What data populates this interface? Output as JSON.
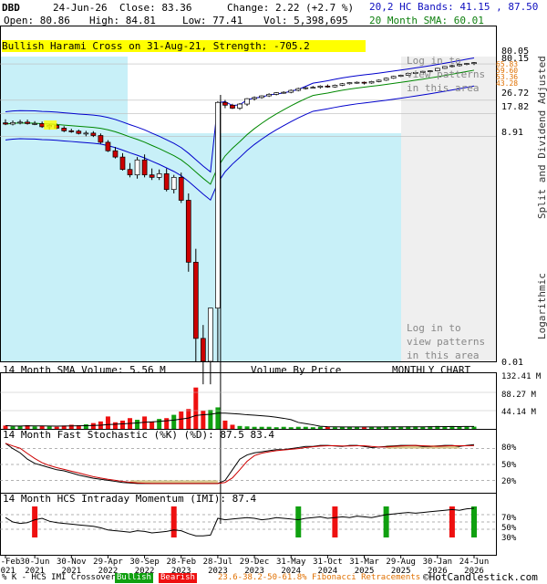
{
  "header": {
    "ticker": "DBD",
    "date": "24-Jun-26",
    "close": "Close: 83.36",
    "change": "Change: 2.22 (+2.7 %)",
    "open": "Open: 80.86",
    "high": "High: 84.81",
    "low": "Low: 77.41",
    "vol": "Vol: 5,398,695",
    "bands": "20,2 HC Bands: 41.15 , 87.50",
    "sma": "20 Month SMA: 60.01"
  },
  "pattern_banner": "Bullish Harami Cross on 31-Aug-21, Strength: -705.2",
  "login_text_1": "Log in to\nview patterns\nin this area",
  "login_text_2": "Log in to\nview patterns\nin this area",
  "right_axis_main": [
    "80.05",
    "80.15",
    "26.72",
    "17.82",
    "8.91",
    "0.01"
  ],
  "fib_labels": [
    "65.83",
    "59.60",
    "53.36",
    "43.28"
  ],
  "volume_panel": {
    "label": "14 Month SMA Volume: 5.56 M",
    "vbp": "Volume By Price",
    "chart_type": "MONTHLY CHART",
    "axis": [
      "132.41 M",
      "88.27 M",
      "44.14 M"
    ]
  },
  "stoch_panel": {
    "label": "14 Month Fast Stochastic (%K) (%D): 87.5 83.4",
    "axis": [
      "80%",
      "50%",
      "20%"
    ]
  },
  "momentum_panel": {
    "label": "14 Month HCS Intraday Momentum (IMI): 87.4",
    "axis": [
      "70%",
      "50%",
      "30%"
    ]
  },
  "side_labels": {
    "split": "Split and Dividend Adjusted",
    "log": "Logarithmic"
  },
  "x_labels": [
    [
      "26-Feb",
      "2021"
    ],
    [
      "30-Jun",
      "2021"
    ],
    [
      "30-Nov",
      "2021"
    ],
    [
      "29-Apr",
      "2022"
    ],
    [
      "30-Sep",
      "2022"
    ],
    [
      "28-Feb",
      "2023"
    ],
    [
      "28-Jul",
      "2023"
    ],
    [
      "29-Dec",
      "2023"
    ],
    [
      "31-May",
      "2024"
    ],
    [
      "31-Oct",
      "2024"
    ],
    [
      "31-Mar",
      "2025"
    ],
    [
      "29-Aug",
      "2025"
    ],
    [
      "30-Jan",
      "2026"
    ],
    [
      "24-Jun",
      "2026"
    ]
  ],
  "footer": {
    "legend": "% K - HCS IMI Crossover:",
    "bullish": "Bullish",
    "bearish": "Bearish",
    "fib": "23.6-38.2-50-61.8% Fibonacci Retracements",
    "copyright": "©HotCandlestick.com"
  },
  "colors": {
    "up": "#ffffff",
    "down": "#cc0000",
    "bull_bar": "#10a010",
    "bear_bar": "#ee1010",
    "band": "#0000cc",
    "sma": "#008800",
    "highlight": "#ffff00",
    "shade": "#c8f0f8"
  },
  "chart_data": {
    "type": "candlestick",
    "title": "DBD",
    "y_scale": "log",
    "ylim": [
      0.01,
      100
    ],
    "x": [
      "2021-02",
      "2021-03",
      "2021-04",
      "2021-05",
      "2021-06",
      "2021-07",
      "2021-08",
      "2021-09",
      "2021-10",
      "2021-11",
      "2021-12",
      "2022-01",
      "2022-02",
      "2022-03",
      "2022-04",
      "2022-05",
      "2022-06",
      "2022-07",
      "2022-08",
      "2022-09",
      "2022-10",
      "2022-11",
      "2022-12",
      "2023-01",
      "2023-02",
      "2023-03",
      "2023-04",
      "2023-05",
      "2023-06",
      "2023-07",
      "2023-08",
      "2023-09",
      "2023-10",
      "2023-11",
      "2023-12",
      "2024-01",
      "2024-02",
      "2024-03",
      "2024-04",
      "2024-05",
      "2024-06",
      "2024-07",
      "2024-08",
      "2024-09",
      "2024-10",
      "2024-11",
      "2024-12",
      "2025-01",
      "2025-02",
      "2025-03",
      "2025-04",
      "2025-05",
      "2025-06",
      "2025-07",
      "2025-08",
      "2025-09",
      "2025-10",
      "2025-11",
      "2025-12",
      "2026-01",
      "2026-02",
      "2026-03",
      "2026-04",
      "2026-05",
      "2026-06"
    ],
    "series": [
      {
        "name": "open",
        "values": [
          13.5,
          13.0,
          13.6,
          13.8,
          13.2,
          13.2,
          12.0,
          12.5,
          11.5,
          10.6,
          10.5,
          9.8,
          9.9,
          9.2,
          7.5,
          5.8,
          4.8,
          3.3,
          2.8,
          4.4,
          2.8,
          2.6,
          2.9,
          1.8,
          2.6,
          1.3,
          0.2,
          0.02,
          0.01,
          0.05,
          25.0,
          23.0,
          21.0,
          23.8,
          28.0,
          29.0,
          30.5,
          32.0,
          33.5,
          34.0,
          36.0,
          38.0,
          39.0,
          39.5,
          41.0,
          40.0,
          42.0,
          44.0,
          45.5,
          46.0,
          45.0,
          47.0,
          49.0,
          52.0,
          55.0,
          57.0,
          60.0,
          62.0,
          64.0,
          65.0,
          70.0,
          74.0,
          76.0,
          79.0,
          80.86
        ]
      },
      {
        "name": "high",
        "values": [
          15.0,
          14.5,
          14.8,
          14.9,
          14.2,
          14.0,
          13.0,
          13.2,
          12.2,
          11.3,
          11.0,
          10.6,
          10.5,
          9.8,
          8.0,
          6.5,
          5.4,
          4.0,
          4.8,
          5.2,
          3.4,
          3.3,
          3.4,
          2.8,
          3.0,
          1.6,
          0.3,
          0.03,
          0.05,
          26.0,
          27.0,
          24.0,
          24.5,
          28.5,
          30.0,
          31.0,
          33.0,
          34.0,
          35.0,
          37.0,
          39.0,
          40.0,
          41.0,
          42.0,
          43.0,
          43.0,
          45.0,
          46.0,
          47.0,
          47.0,
          48.0,
          50.0,
          53.0,
          56.0,
          58.0,
          61.0,
          63.0,
          65.0,
          66.0,
          71.0,
          75.0,
          78.0,
          80.0,
          82.0,
          84.81
        ]
      },
      {
        "name": "low",
        "values": [
          12.6,
          12.5,
          12.9,
          12.8,
          12.6,
          11.6,
          11.0,
          11.2,
          10.2,
          10.0,
          9.5,
          9.0,
          8.8,
          7.2,
          5.6,
          4.6,
          3.2,
          2.6,
          2.5,
          2.6,
          2.4,
          2.4,
          1.7,
          1.6,
          1.2,
          0.15,
          0.01,
          0.005,
          0.005,
          0.01,
          21.0,
          20.5,
          20.0,
          22.5,
          26.5,
          28.0,
          29.5,
          31.0,
          32.5,
          33.0,
          35.0,
          37.0,
          38.0,
          38.0,
          39.0,
          39.0,
          41.0,
          43.0,
          44.0,
          43.0,
          44.0,
          46.0,
          48.0,
          51.0,
          54.0,
          56.0,
          59.0,
          61.0,
          62.0,
          64.0,
          69.0,
          72.0,
          74.0,
          77.0,
          77.41
        ]
      },
      {
        "name": "close",
        "values": [
          13.0,
          13.6,
          13.8,
          13.2,
          13.2,
          12.0,
          12.5,
          11.5,
          10.6,
          10.5,
          9.8,
          9.9,
          9.2,
          7.5,
          5.8,
          4.8,
          3.3,
          2.8,
          4.4,
          2.8,
          2.6,
          2.9,
          1.8,
          2.6,
          1.3,
          0.2,
          0.02,
          0.01,
          0.05,
          25.0,
          23.0,
          21.0,
          23.8,
          28.0,
          29.0,
          30.5,
          32.0,
          33.5,
          34.0,
          36.0,
          38.0,
          39.0,
          39.5,
          41.0,
          40.0,
          42.0,
          44.0,
          45.5,
          46.0,
          45.0,
          47.0,
          49.0,
          52.0,
          55.0,
          57.0,
          60.0,
          62.0,
          64.0,
          65.0,
          70.0,
          74.0,
          76.0,
          79.0,
          81.14,
          83.36
        ]
      },
      {
        "name": "volume",
        "values": [
          8,
          6,
          7,
          9,
          6,
          7,
          6,
          5,
          8,
          10,
          9,
          11,
          14,
          18,
          30,
          16,
          20,
          26,
          22,
          30,
          18,
          24,
          26,
          34,
          42,
          48,
          100,
          44,
          46,
          52,
          20,
          10,
          7,
          6,
          5,
          5,
          5,
          4,
          5,
          4,
          5,
          5,
          4,
          5,
          5,
          4,
          5,
          5,
          5,
          4,
          5,
          5,
          6,
          5,
          5,
          6,
          6,
          5,
          6,
          7,
          6,
          7,
          6,
          6,
          5.4
        ]
      },
      {
        "name": "stoch_k",
        "values": [
          90,
          80,
          72,
          60,
          52,
          48,
          44,
          40,
          38,
          34,
          30,
          27,
          24,
          22,
          20,
          18,
          16,
          15,
          14,
          14,
          14,
          14,
          14,
          14,
          14,
          14,
          14,
          14,
          14,
          14,
          20,
          40,
          60,
          68,
          72,
          74,
          76,
          78,
          78,
          80,
          82,
          84,
          84,
          86,
          86,
          85,
          84,
          86,
          86,
          84,
          82,
          83,
          84,
          85,
          86,
          86,
          86,
          84,
          84,
          85,
          86,
          86,
          84,
          86,
          87.5
        ]
      },
      {
        "name": "imi",
        "values": [
          62,
          50,
          46,
          48,
          56,
          60,
          52,
          48,
          46,
          44,
          42,
          40,
          38,
          34,
          28,
          26,
          24,
          22,
          26,
          24,
          20,
          22,
          24,
          28,
          26,
          18,
          12,
          12,
          14,
          60,
          56,
          58,
          60,
          62,
          60,
          56,
          58,
          62,
          60,
          58,
          56,
          60,
          62,
          64,
          60,
          62,
          64,
          62,
          66,
          64,
          62,
          66,
          70,
          72,
          74,
          76,
          74,
          76,
          78,
          80,
          82,
          84,
          82,
          86,
          87.4
        ]
      }
    ]
  }
}
